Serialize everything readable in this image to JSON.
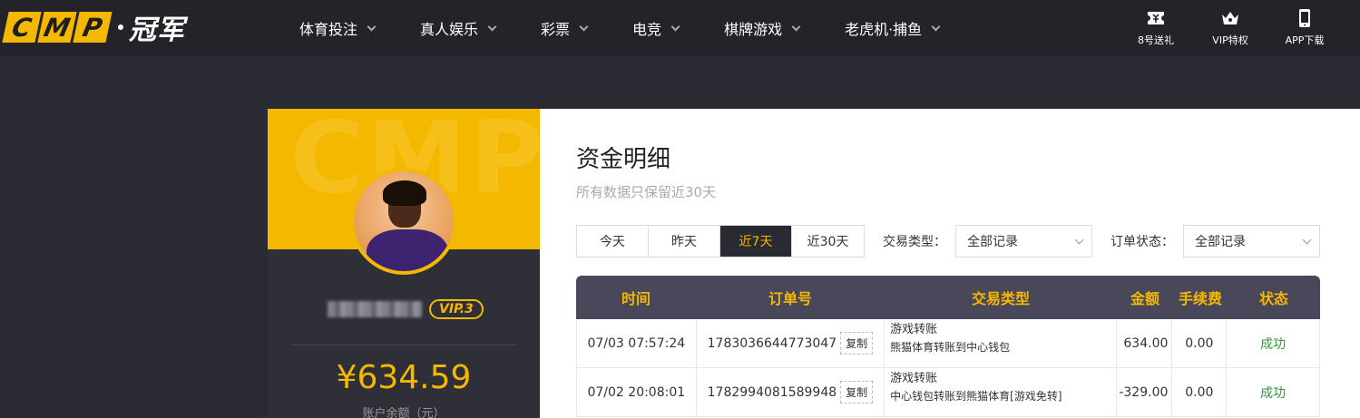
{
  "header": {
    "logo_letters": [
      "C",
      "M",
      "P"
    ],
    "logo_cn": "冠军",
    "nav": [
      {
        "label": "体育投注"
      },
      {
        "label": "真人娱乐"
      },
      {
        "label": "彩票"
      },
      {
        "label": "电竞"
      },
      {
        "label": "棋牌游戏"
      },
      {
        "label": "老虎机·捕鱼"
      }
    ],
    "actions": [
      {
        "label": "8号送礼",
        "icon": "gift-ticket-icon"
      },
      {
        "label": "VIP特权",
        "icon": "crown-icon"
      },
      {
        "label": "APP下载",
        "icon": "phone-icon"
      }
    ]
  },
  "profile": {
    "banner_text": "CMP",
    "vip": "VIP.3",
    "balance": "¥634.59",
    "balance_label": "账户余额（元）"
  },
  "main": {
    "title": "资金明细",
    "subtitle": "所有数据只保留近30天",
    "date_tabs": [
      {
        "label": "今天",
        "active": false
      },
      {
        "label": "昨天",
        "active": false
      },
      {
        "label": "近7天",
        "active": true
      },
      {
        "label": "近30天",
        "active": false
      }
    ],
    "filters": {
      "type_label": "交易类型：",
      "type_value": "全部记录",
      "status_label": "订单状态：",
      "status_value": "全部记录"
    },
    "table": {
      "headers": [
        "时间",
        "订单号",
        "交易类型",
        "金额",
        "手续费",
        "状态"
      ],
      "copy_label": "复制",
      "rows": [
        {
          "time": "07/03 07:57:24",
          "order": "1783036644773047",
          "type": "游戏转账",
          "type_detail": "熊猫体育转账到中心钱包",
          "amount": "634.00",
          "fee": "0.00",
          "status": "成功"
        },
        {
          "time": "07/02 20:08:01",
          "order": "1782994081589948",
          "type": "游戏转账",
          "type_detail": "中心钱包转账到熊猫体育[游戏免转]",
          "amount": "-329.00",
          "fee": "0.00",
          "status": "成功"
        }
      ]
    }
  },
  "colors": {
    "accent": "#f5b800",
    "header_bg": "#232329",
    "page_bg": "#2a2a32",
    "success": "#2e9a3a"
  }
}
